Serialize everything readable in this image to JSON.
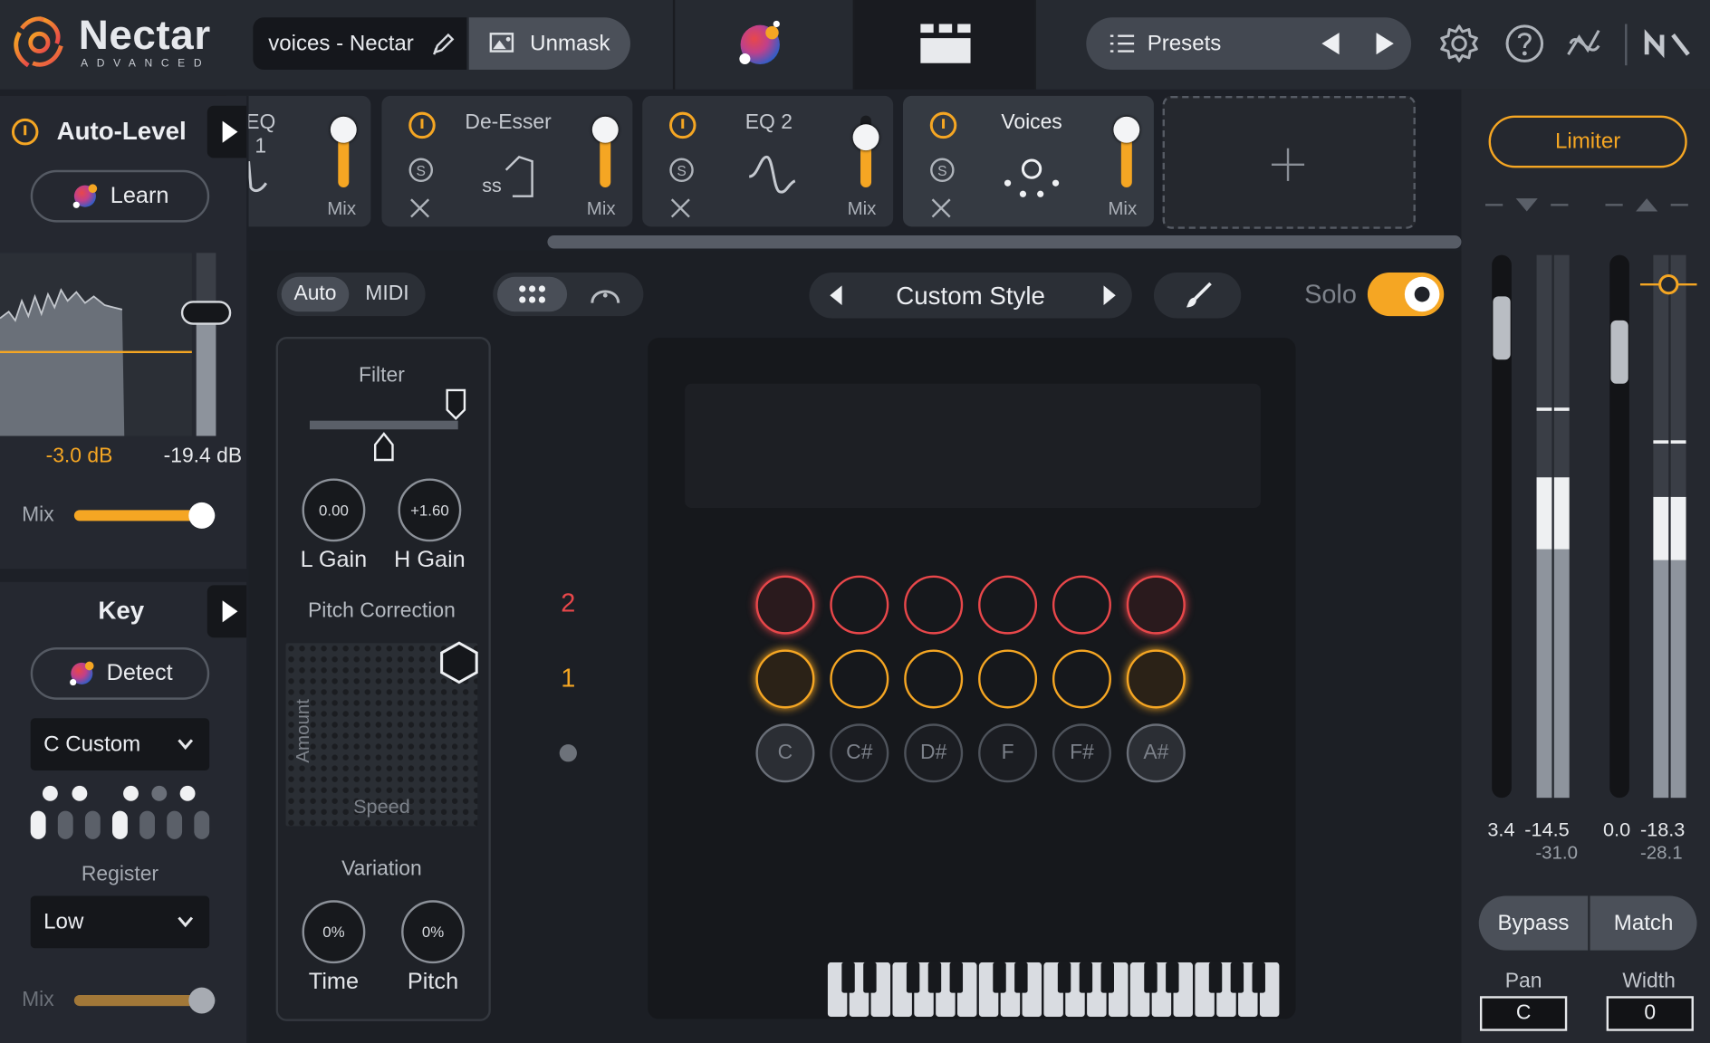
{
  "app": {
    "logo_text": "Nectar",
    "logo_sub": "ADVANCED",
    "preset_name": "voices - Nectar",
    "unmask_label": "Unmask",
    "presets_label": "Presets"
  },
  "modules": [
    {
      "title": "EQ 1",
      "mix_label": "Mix",
      "mix_level": 0.8
    },
    {
      "title": "De-Esser",
      "mix_label": "Mix",
      "mix_level": 0.8
    },
    {
      "title": "EQ 2",
      "mix_label": "Mix",
      "mix_level": 0.7
    },
    {
      "title": "Voices",
      "mix_label": "Mix",
      "mix_level": 0.8
    }
  ],
  "auto_level": {
    "title": "Auto-Level",
    "learn_label": "Learn",
    "left_db": "-3.0 dB",
    "right_db": "-19.4 dB",
    "mix_label": "Mix",
    "mix_value": 0.9
  },
  "key": {
    "title": "Key",
    "detect_label": "Detect",
    "scale_value": "C Custom",
    "register_label": "Register",
    "register_value": "Low",
    "mix_label": "Mix",
    "mix_value": 0.9
  },
  "voices_editor": {
    "mode_auto": "Auto",
    "mode_midi": "MIDI",
    "style_name": "Custom Style",
    "solo_label": "Solo",
    "solo_on": true,
    "filter_label": "Filter",
    "low_gain_value": "0.00",
    "low_gain_label": "L Gain",
    "high_gain_value": "+1.60",
    "high_gain_label": "H Gain",
    "pitch_correction_label": "Pitch Correction",
    "amount_label": "Amount",
    "speed_label": "Speed",
    "variation_label": "Variation",
    "time_value": "0%",
    "time_label": "Time",
    "pitch_value": "0%",
    "pitch_label": "Pitch",
    "row_labels": [
      "2",
      "1"
    ],
    "notes": [
      "C",
      "C#",
      "D#",
      "F",
      "F#",
      "A#"
    ]
  },
  "output": {
    "limiter_label": "Limiter",
    "meter_values": [
      "3.4",
      "-14.5",
      "-31.0",
      "0.0",
      "-18.3",
      "-28.1"
    ],
    "bypass_label": "Bypass",
    "match_label": "Match",
    "pan_label": "Pan",
    "pan_value": "C",
    "width_label": "Width",
    "width_value": "0"
  },
  "colors": {
    "accent": "#f5a623",
    "voice_row_2": "#e8474a",
    "voice_row_1": "#f5a623"
  },
  "icons": [
    "settings-gear-icon",
    "help-icon",
    "plugin-link-icon",
    "ni-logo-icon",
    "power-icon",
    "solo-icon",
    "close-icon",
    "add-icon",
    "list-icon",
    "prev-arrow-icon",
    "next-arrow-icon",
    "brush-icon",
    "grid-dots-icon",
    "arc-icon"
  ]
}
